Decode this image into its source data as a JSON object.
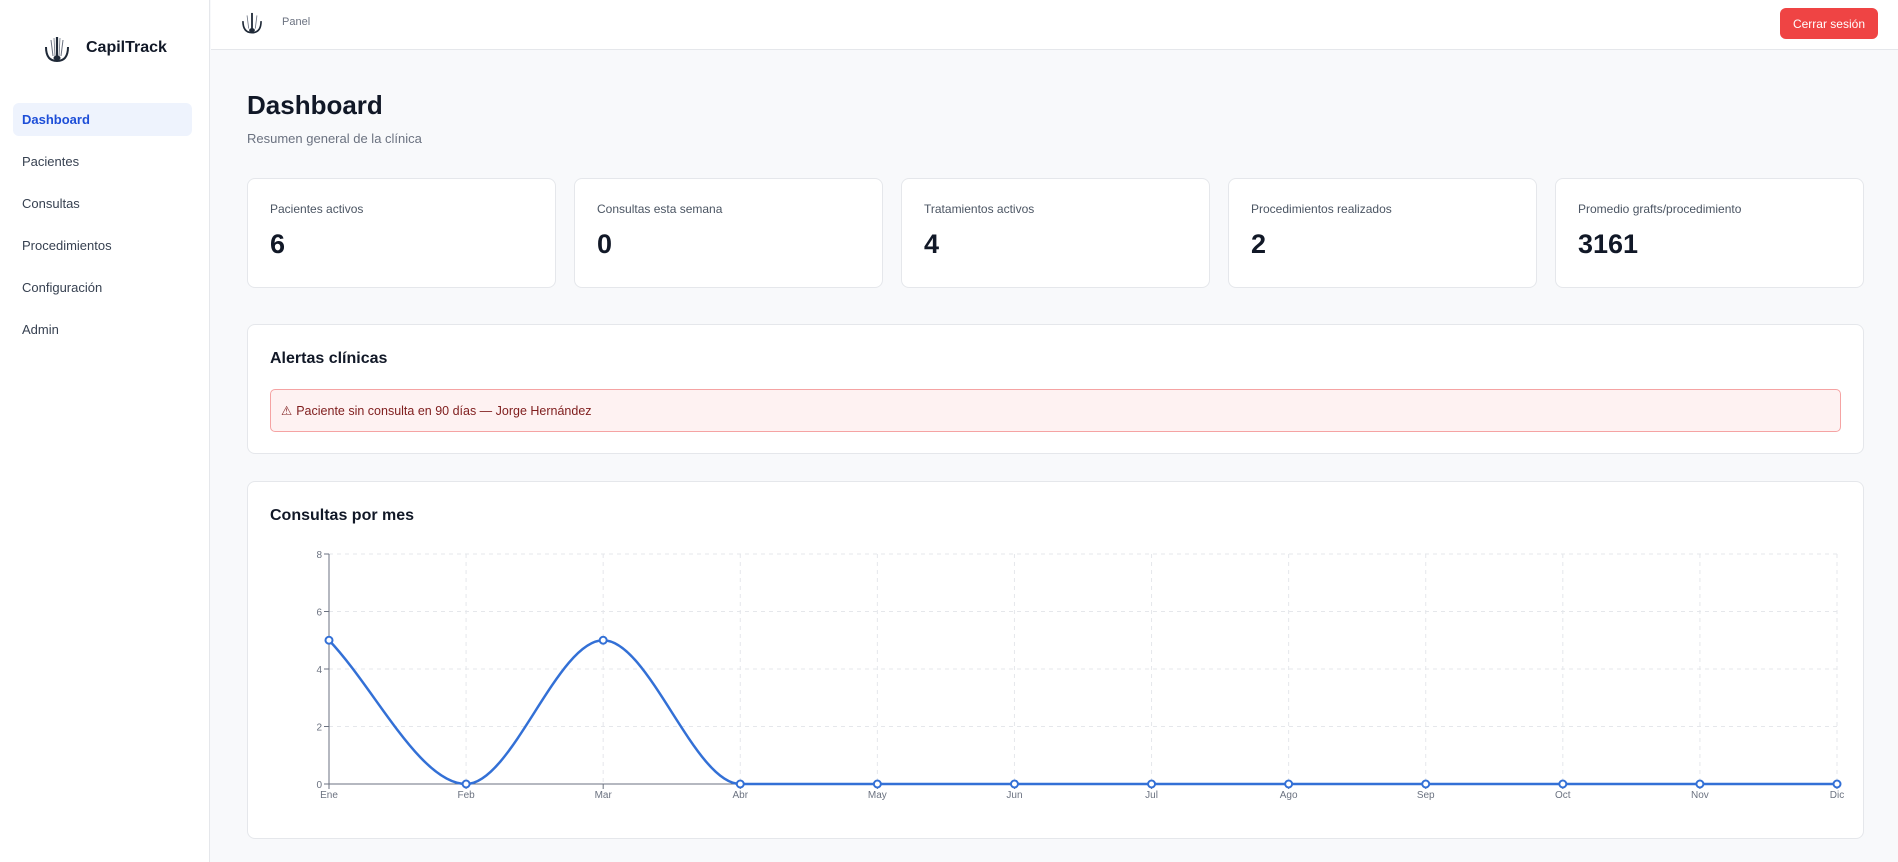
{
  "app": {
    "name": "CapilTrack",
    "logo_icon": "hair-follicle-icon"
  },
  "sidebar": {
    "items": [
      {
        "label": "Dashboard",
        "active": true
      },
      {
        "label": "Pacientes",
        "active": false
      },
      {
        "label": "Consultas",
        "active": false
      },
      {
        "label": "Procedimientos",
        "active": false
      },
      {
        "label": "Configuración",
        "active": false
      },
      {
        "label": "Admin",
        "active": false
      }
    ]
  },
  "topbar": {
    "breadcrumb": "Panel",
    "logout_label": "Cerrar sesión"
  },
  "page": {
    "title": "Dashboard",
    "subtitle": "Resumen general de la clínica"
  },
  "stats": [
    {
      "label": "Pacientes activos",
      "value": "6"
    },
    {
      "label": "Consultas esta semana",
      "value": "0"
    },
    {
      "label": "Tratamientos activos",
      "value": "4"
    },
    {
      "label": "Procedimientos realizados",
      "value": "2"
    },
    {
      "label": "Promedio grafts/procedimiento",
      "value": "3161"
    }
  ],
  "alerts": {
    "title": "Alertas clínicas",
    "items": [
      {
        "icon": "warning-icon",
        "icon_glyph": "⚠",
        "text": "Paciente sin consulta en 90 días — Jorge Hernández"
      }
    ]
  },
  "chart": {
    "title": "Consultas por mes"
  },
  "chart_data": {
    "type": "line",
    "title": "Consultas por mes",
    "categories": [
      "Ene",
      "Feb",
      "Mar",
      "Abr",
      "May",
      "Jun",
      "Jul",
      "Ago",
      "Sep",
      "Oct",
      "Nov",
      "Dic"
    ],
    "series": [
      {
        "values": [
          5,
          0,
          5,
          0,
          0,
          0,
          0,
          0,
          0,
          0,
          0,
          0
        ]
      }
    ],
    "ylim": [
      0,
      8
    ],
    "yticks": [
      0,
      2,
      4,
      6,
      8
    ],
    "xlabel": "",
    "ylabel": "",
    "grid": true,
    "smooth": true,
    "legend": "none"
  },
  "colors": {
    "accent": "#1d4ed8",
    "line": "#3370d6",
    "danger": "#ef4444",
    "alert_bg": "#fef2f2",
    "alert_border": "#f5a3a3",
    "alert_text": "#7f1d1d"
  }
}
